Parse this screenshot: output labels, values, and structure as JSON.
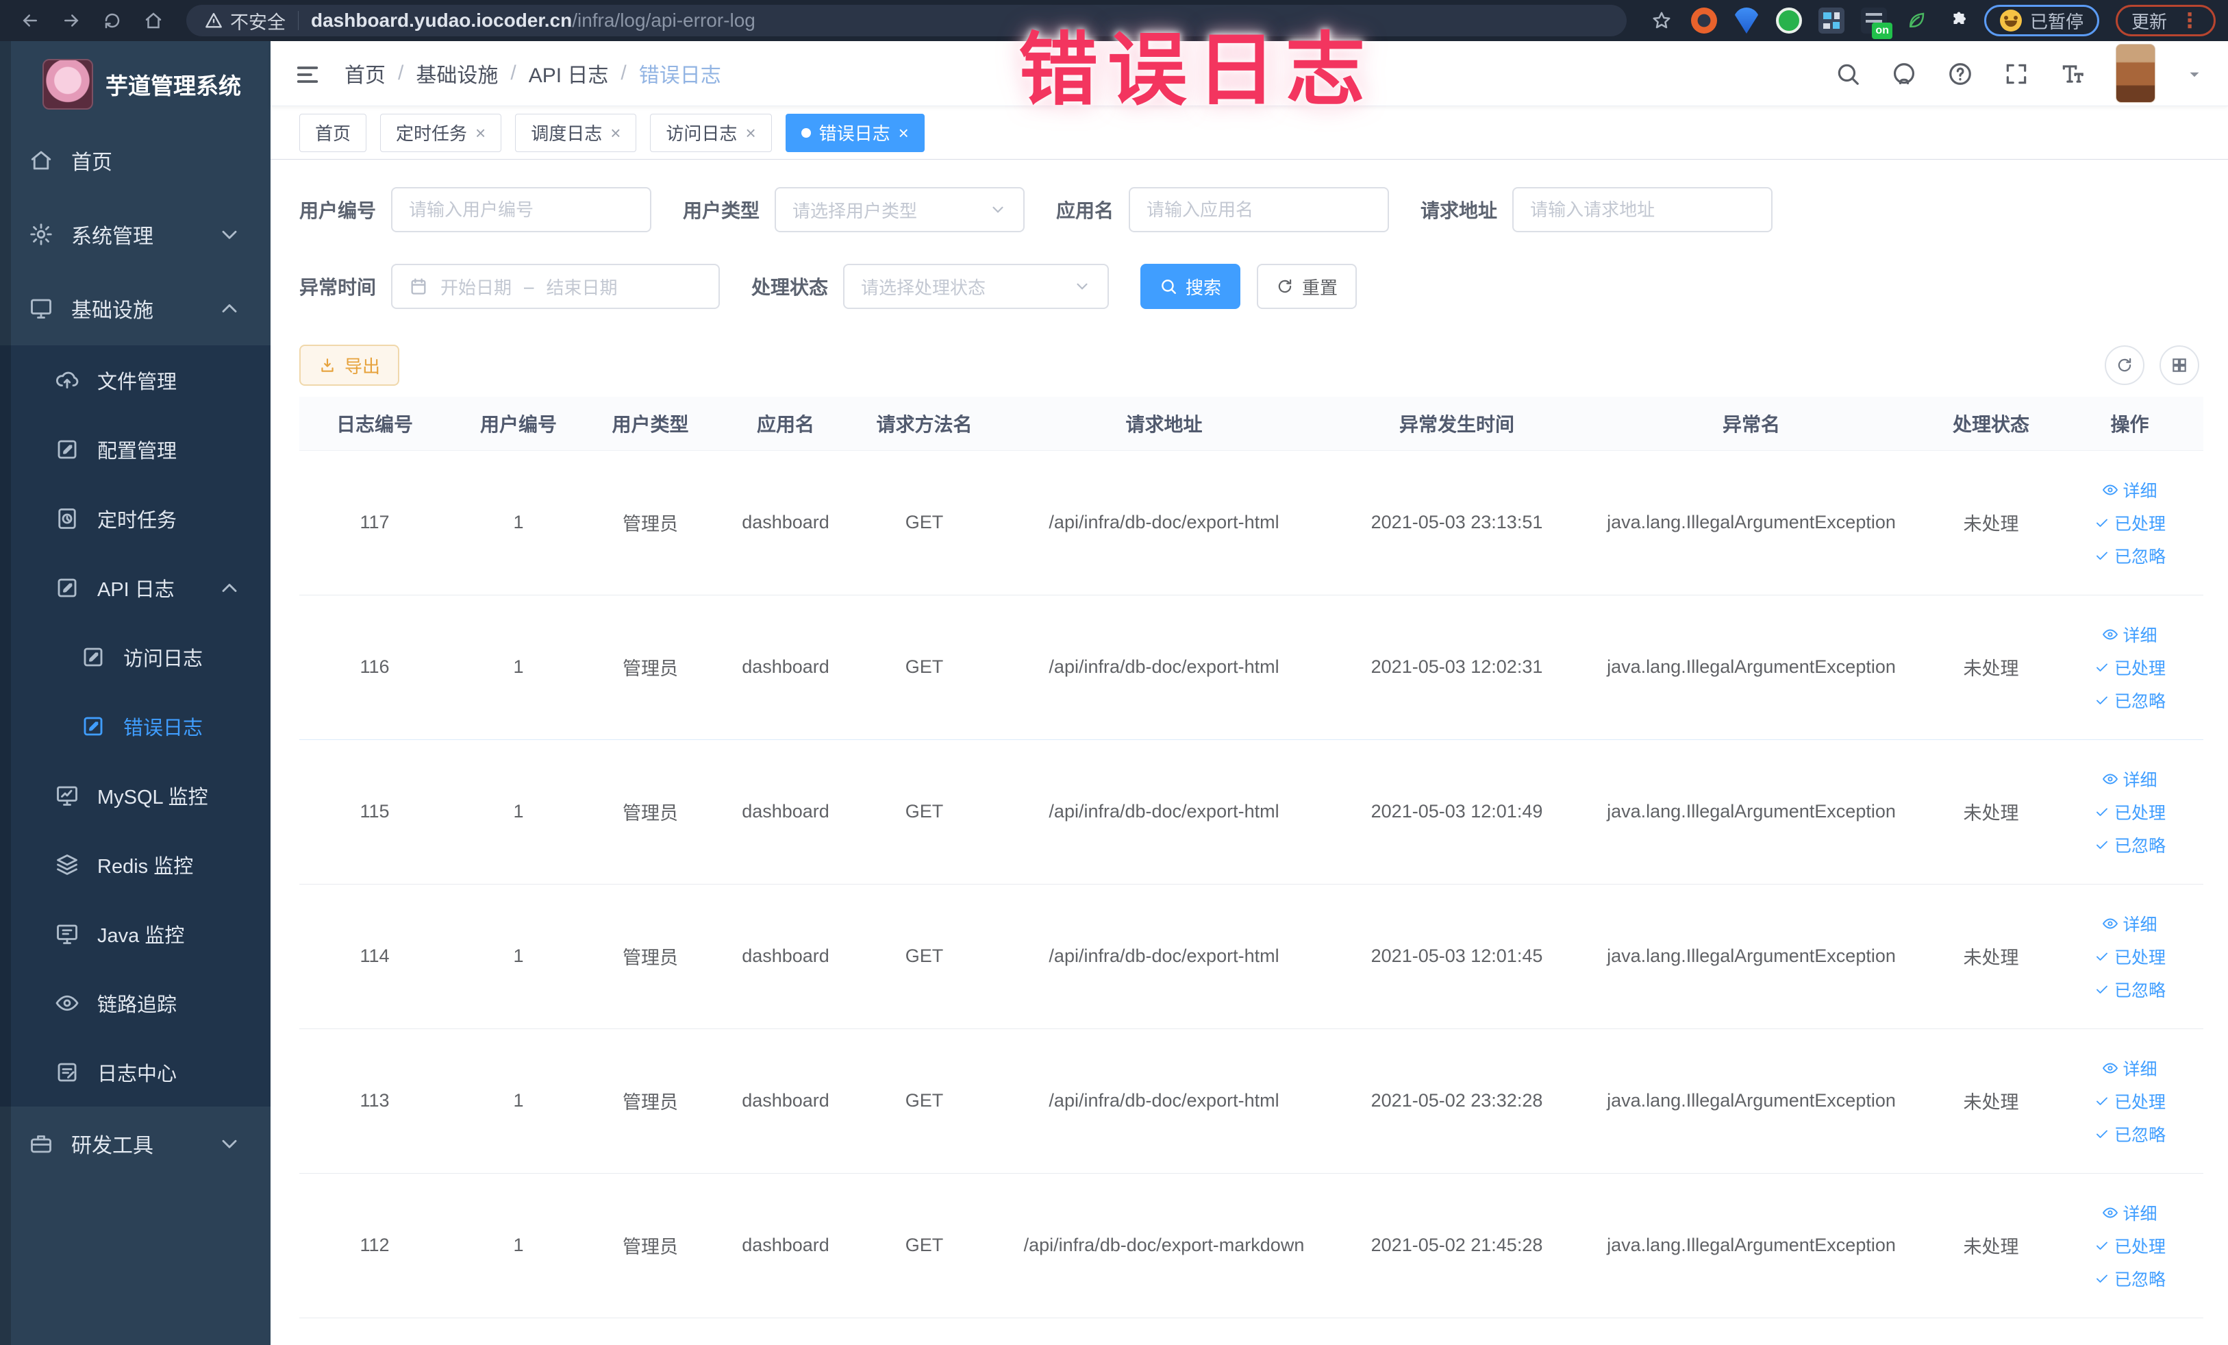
{
  "browser": {
    "security_label": "不安全",
    "url_host": "dashboard.yudao.iocoder.cn",
    "url_path": "/infra/log/api-error-log",
    "on_badge": "on",
    "paused_label": "已暂停",
    "update_label": "更新"
  },
  "overlay": {
    "text": "错误日志",
    "color": "#f3355f"
  },
  "sidebar": {
    "logo_title": "芋道管理系统",
    "menu": [
      {
        "label": "首页",
        "icon": "home",
        "level": 1
      },
      {
        "label": "系统管理",
        "icon": "gear",
        "level": 1,
        "chevron": "down"
      },
      {
        "label": "基础设施",
        "icon": "monitor",
        "level": 1,
        "chevron": "up"
      },
      {
        "group": true,
        "items": [
          {
            "label": "文件管理",
            "icon": "cloud-upload",
            "level": 2
          },
          {
            "label": "配置管理",
            "icon": "edit",
            "level": 2
          },
          {
            "label": "定时任务",
            "icon": "timer",
            "level": 2
          },
          {
            "label": "API 日志",
            "icon": "edit-square",
            "level": 2,
            "chevron": "up"
          },
          {
            "label": "访问日志",
            "icon": "edit-square",
            "level": 3
          },
          {
            "label": "错误日志",
            "icon": "edit-square",
            "level": 3,
            "active": true
          },
          {
            "label": "MySQL 监控",
            "icon": "chart-monitor",
            "level": 2
          },
          {
            "label": "Redis 监控",
            "icon": "layers",
            "level": 2
          },
          {
            "label": "Java 监控",
            "icon": "java-monitor",
            "level": 2
          },
          {
            "label": "链路追踪",
            "icon": "eye",
            "level": 2
          },
          {
            "label": "日志中心",
            "icon": "log-center",
            "level": 2
          }
        ]
      },
      {
        "label": "研发工具",
        "icon": "briefcase",
        "level": 1,
        "chevron": "down"
      }
    ]
  },
  "header": {
    "breadcrumb": [
      "首页",
      "基础设施",
      "API 日志",
      "错误日志"
    ],
    "icons": [
      "search",
      "github",
      "help",
      "fullscreen",
      "font-size",
      "avatar",
      "caret"
    ]
  },
  "tabs": [
    {
      "label": "首页",
      "closable": false,
      "active": false
    },
    {
      "label": "定时任务",
      "closable": true,
      "active": false
    },
    {
      "label": "调度日志",
      "closable": true,
      "active": false
    },
    {
      "label": "访问日志",
      "closable": true,
      "active": false
    },
    {
      "label": "错误日志",
      "closable": true,
      "active": true
    }
  ],
  "filters": {
    "user_id_label": "用户编号",
    "user_id_placeholder": "请输入用户编号",
    "user_type_label": "用户类型",
    "user_type_placeholder": "请选择用户类型",
    "app_name_label": "应用名",
    "app_name_placeholder": "请输入应用名",
    "request_url_label": "请求地址",
    "request_url_placeholder": "请输入请求地址",
    "error_time_label": "异常时间",
    "start_date_placeholder": "开始日期",
    "range_separator": "–",
    "end_date_placeholder": "结束日期",
    "process_status_label": "处理状态",
    "process_status_placeholder": "请选择处理状态",
    "search_label": "搜索",
    "reset_label": "重置"
  },
  "toolbar": {
    "export_label": "导出"
  },
  "table": {
    "columns": [
      "日志编号",
      "用户编号",
      "用户类型",
      "应用名",
      "请求方法名",
      "请求地址",
      "异常发生时间",
      "异常名",
      "处理状态",
      "操作"
    ],
    "row_actions": [
      "详细",
      "已处理",
      "已忽略"
    ],
    "rows": [
      {
        "id": "117",
        "user_id": "1",
        "user_type": "管理员",
        "app_name": "dashboard",
        "method": "GET",
        "url": "/api/infra/db-doc/export-html",
        "time": "2021-05-03 23:13:51",
        "exception": "java.lang.IllegalArgumentException",
        "status": "未处理"
      },
      {
        "id": "116",
        "user_id": "1",
        "user_type": "管理员",
        "app_name": "dashboard",
        "method": "GET",
        "url": "/api/infra/db-doc/export-html",
        "time": "2021-05-03 12:02:31",
        "exception": "java.lang.IllegalArgumentException",
        "status": "未处理"
      },
      {
        "id": "115",
        "user_id": "1",
        "user_type": "管理员",
        "app_name": "dashboard",
        "method": "GET",
        "url": "/api/infra/db-doc/export-html",
        "time": "2021-05-03 12:01:49",
        "exception": "java.lang.IllegalArgumentException",
        "status": "未处理"
      },
      {
        "id": "114",
        "user_id": "1",
        "user_type": "管理员",
        "app_name": "dashboard",
        "method": "GET",
        "url": "/api/infra/db-doc/export-html",
        "time": "2021-05-03 12:01:45",
        "exception": "java.lang.IllegalArgumentException",
        "status": "未处理"
      },
      {
        "id": "113",
        "user_id": "1",
        "user_type": "管理员",
        "app_name": "dashboard",
        "method": "GET",
        "url": "/api/infra/db-doc/export-html",
        "time": "2021-05-02 23:32:28",
        "exception": "java.lang.IllegalArgumentException",
        "status": "未处理"
      },
      {
        "id": "112",
        "user_id": "1",
        "user_type": "管理员",
        "app_name": "dashboard",
        "method": "GET",
        "url": "/api/infra/db-doc/export-markdown",
        "time": "2021-05-02 21:45:28",
        "exception": "java.lang.IllegalArgumentException",
        "status": "未处理"
      }
    ]
  }
}
